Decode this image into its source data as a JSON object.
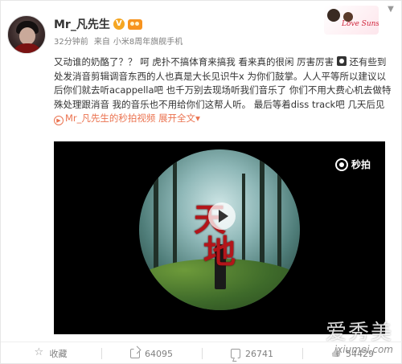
{
  "post": {
    "username": "Mr_凡先生",
    "verified_badge": "V",
    "time": "32分钟前",
    "source_prefix": "来自",
    "source": "小米8周年旗舰手机",
    "text_part1": "又动谁的奶酪了？？ 呵 虎扑不搞体育来搞我 看来真的很闲 厉害厉害",
    "text_part2": " 还有些到处发消音剪辑调音东西的人也真是大长见识牛x 为你们鼓掌。人人平等所以建议以后你们就去听acappella吧 也千万别去现场听我们音乐了 你们不用大费心机去做特殊处理跟消音 我的音乐也不用给你们这帮人听。 最后等着diss track吧 几天后见 ",
    "video_link": "Mr_凡先生的秒拍视频",
    "expand_label": "展开全文",
    "expand_chevron": "▾"
  },
  "sticker": {
    "text": "Love Sunshine"
  },
  "video": {
    "logo_text": "秒拍",
    "title_char1": "天",
    "title_char2": "地"
  },
  "actions": {
    "favorite_label": "收藏",
    "share_count": "64095",
    "comment_count": "26741",
    "like_count": "54429"
  },
  "watermark": {
    "chinese": "爱秀美",
    "pinyin": "ixiumei.com"
  },
  "colors": {
    "link": "#eb7350",
    "title_red": "#b3151a"
  }
}
